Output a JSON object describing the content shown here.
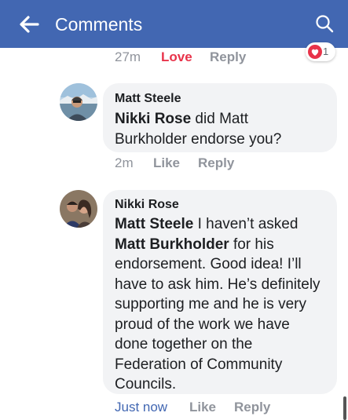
{
  "appbar": {
    "title": "Comments",
    "back_icon": "back-arrow-icon",
    "search_icon": "search-icon",
    "color": "#4267b2"
  },
  "prev_comment": {
    "time": "27m",
    "love": "Love",
    "reply": "Reply",
    "reaction_count": "1",
    "love_color": "#e8334a"
  },
  "comment1": {
    "author": "Matt Steele",
    "mention": "Nikki Rose",
    "text_line1": " did Matt",
    "text_line2": "Burkholder endorse you?",
    "time": "2m",
    "like": "Like",
    "reply": "Reply"
  },
  "comment2": {
    "author": "Nikki Rose",
    "mention1": "Matt Steele",
    "line1_rest": " I haven’t asked",
    "mention2": "Matt Burkholder",
    "line2_rest": " for his",
    "lines": [
      "endorsement. Good idea!  I’ll",
      "have to ask him. He’s definitely",
      "supporting me and he is very",
      "proud of the work we have",
      "done together on the",
      "Federation of Community",
      "Councils."
    ],
    "time": "Just now",
    "like": "Like",
    "reply": "Reply"
  }
}
